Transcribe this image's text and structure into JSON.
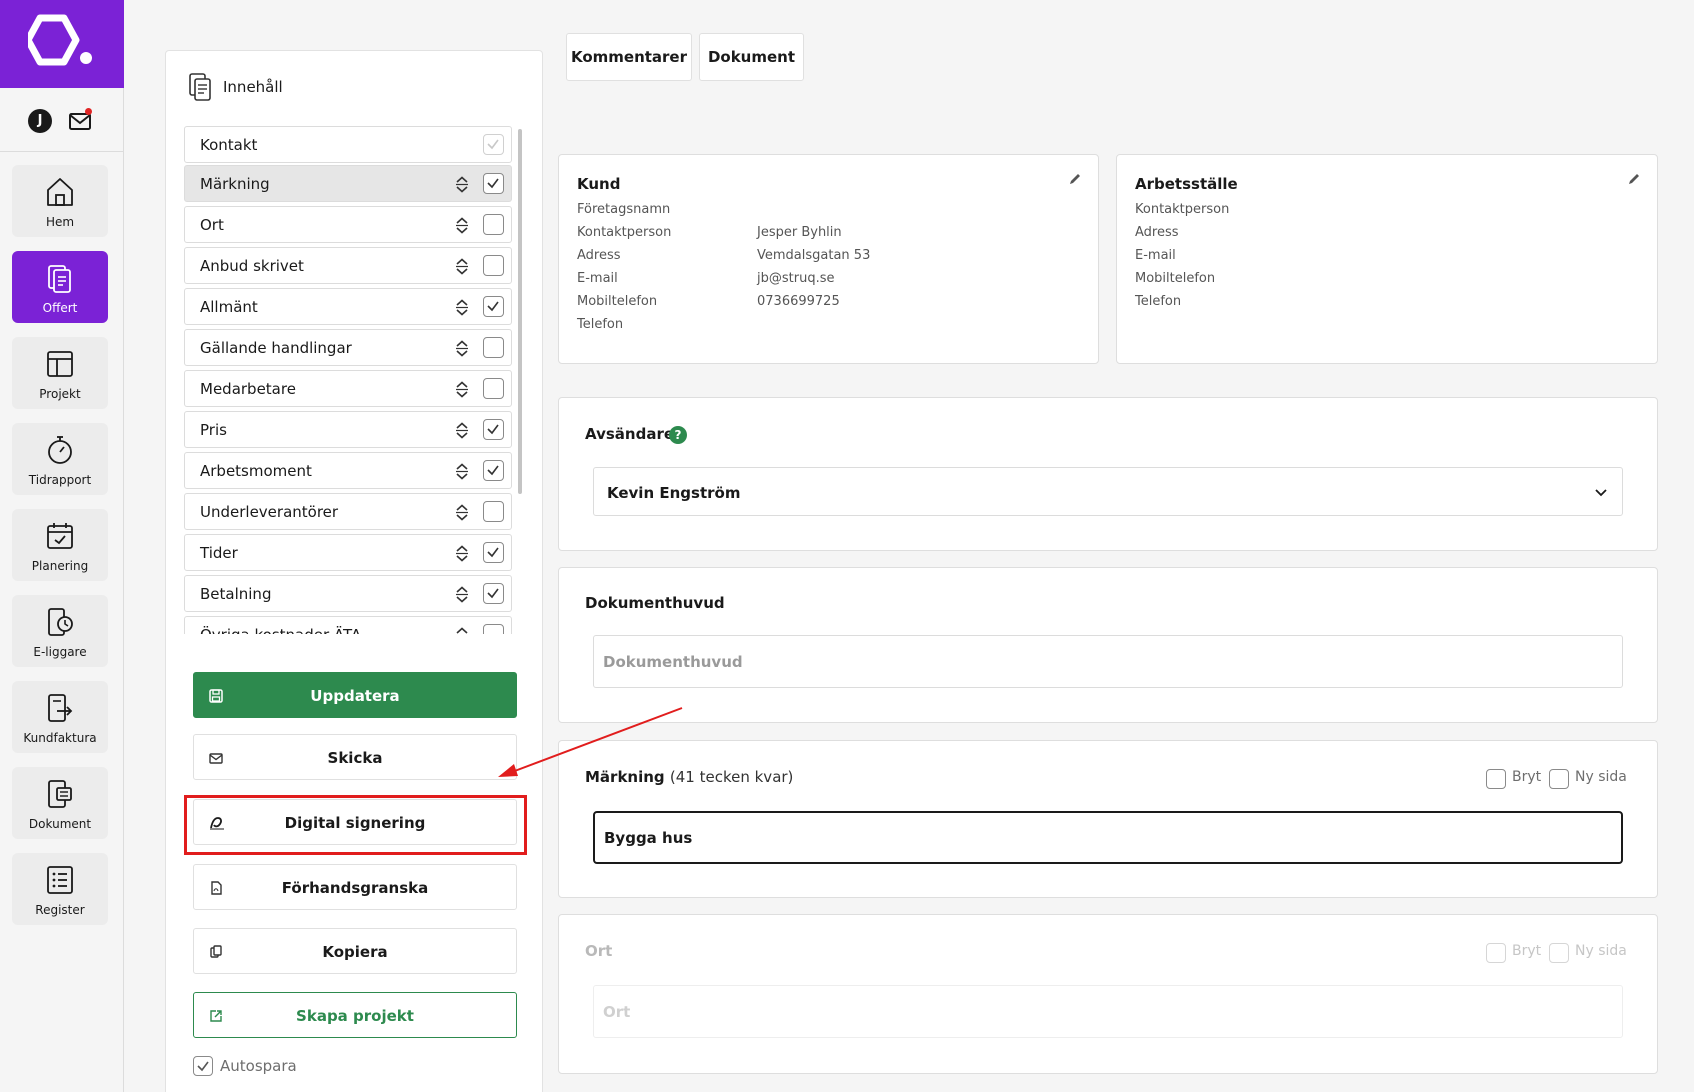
{
  "sidebar": {
    "user_initial": "J",
    "items": [
      {
        "label": "Hem",
        "icon": "home-icon"
      },
      {
        "label": "Offert",
        "icon": "quote-icon"
      },
      {
        "label": "Projekt",
        "icon": "project-icon"
      },
      {
        "label": "Tidrapport",
        "icon": "stopwatch-icon"
      },
      {
        "label": "Planering",
        "icon": "calendar-icon"
      },
      {
        "label": "E-liggare",
        "icon": "phone-clock-icon"
      },
      {
        "label": "Kundfaktura",
        "icon": "invoice-icon"
      },
      {
        "label": "Dokument",
        "icon": "document-icon"
      },
      {
        "label": "Register",
        "icon": "list-icon"
      }
    ],
    "active": "Offert"
  },
  "content": {
    "title": "Innehåll",
    "items": [
      {
        "label": "Kontakt",
        "checked": true,
        "disabled": true
      },
      {
        "label": "Märkning",
        "checked": true,
        "selected": true
      },
      {
        "label": "Ort",
        "checked": false
      },
      {
        "label": "Anbud skrivet",
        "checked": false
      },
      {
        "label": "Allmänt",
        "checked": true
      },
      {
        "label": "Gällande handlingar",
        "checked": false
      },
      {
        "label": "Medarbetare",
        "checked": false
      },
      {
        "label": "Pris",
        "checked": true
      },
      {
        "label": "Arbetsmoment",
        "checked": true
      },
      {
        "label": "Underleverantörer",
        "checked": false
      },
      {
        "label": "Tider",
        "checked": true
      },
      {
        "label": "Betalning",
        "checked": true
      },
      {
        "label": "Övriga kostnader ÄTA",
        "checked": false
      }
    ],
    "buttons": {
      "update": "Uppdatera",
      "send": "Skicka",
      "digital_sign": "Digital signering",
      "preview": "Förhandsgranska",
      "copy": "Kopiera",
      "create_project": "Skapa projekt"
    },
    "autosave_label": "Autospara",
    "autosave_checked": true
  },
  "tabs": [
    "Kommentarer",
    "Dokument"
  ],
  "customer": {
    "title": "Kund",
    "fields": [
      {
        "label": "Företagsnamn",
        "value": ""
      },
      {
        "label": "Kontaktperson",
        "value": "Jesper Byhlin"
      },
      {
        "label": "Adress",
        "value": "Vemdalsgatan 53"
      },
      {
        "label": "E-mail",
        "value": "jb@struq.se"
      },
      {
        "label": "Mobiltelefon",
        "value": "0736699725"
      },
      {
        "label": "Telefon",
        "value": ""
      }
    ]
  },
  "workplace": {
    "title": "Arbetsställe",
    "fields": [
      {
        "label": "Kontaktperson",
        "value": ""
      },
      {
        "label": "Adress",
        "value": ""
      },
      {
        "label": "E-mail",
        "value": ""
      },
      {
        "label": "Mobiltelefon",
        "value": ""
      },
      {
        "label": "Telefon",
        "value": ""
      }
    ]
  },
  "sender": {
    "title": "Avsändare",
    "help": "?",
    "selected": "Kevin Engström"
  },
  "doc_header": {
    "title": "Dokumenthuvud",
    "placeholder": "Dokumenthuvud"
  },
  "marking": {
    "title": "Märkning",
    "remaining": "(41 tecken kvar)",
    "break_label": "Bryt",
    "new_page_label": "Ny sida",
    "value": "Bygga hus"
  },
  "location": {
    "title": "Ort",
    "break_label": "Bryt",
    "new_page_label": "Ny sida",
    "placeholder": "Ort"
  },
  "colors": {
    "brand": "#7b22d6",
    "green": "#2d8a4e",
    "highlight": "#e11d1d"
  }
}
